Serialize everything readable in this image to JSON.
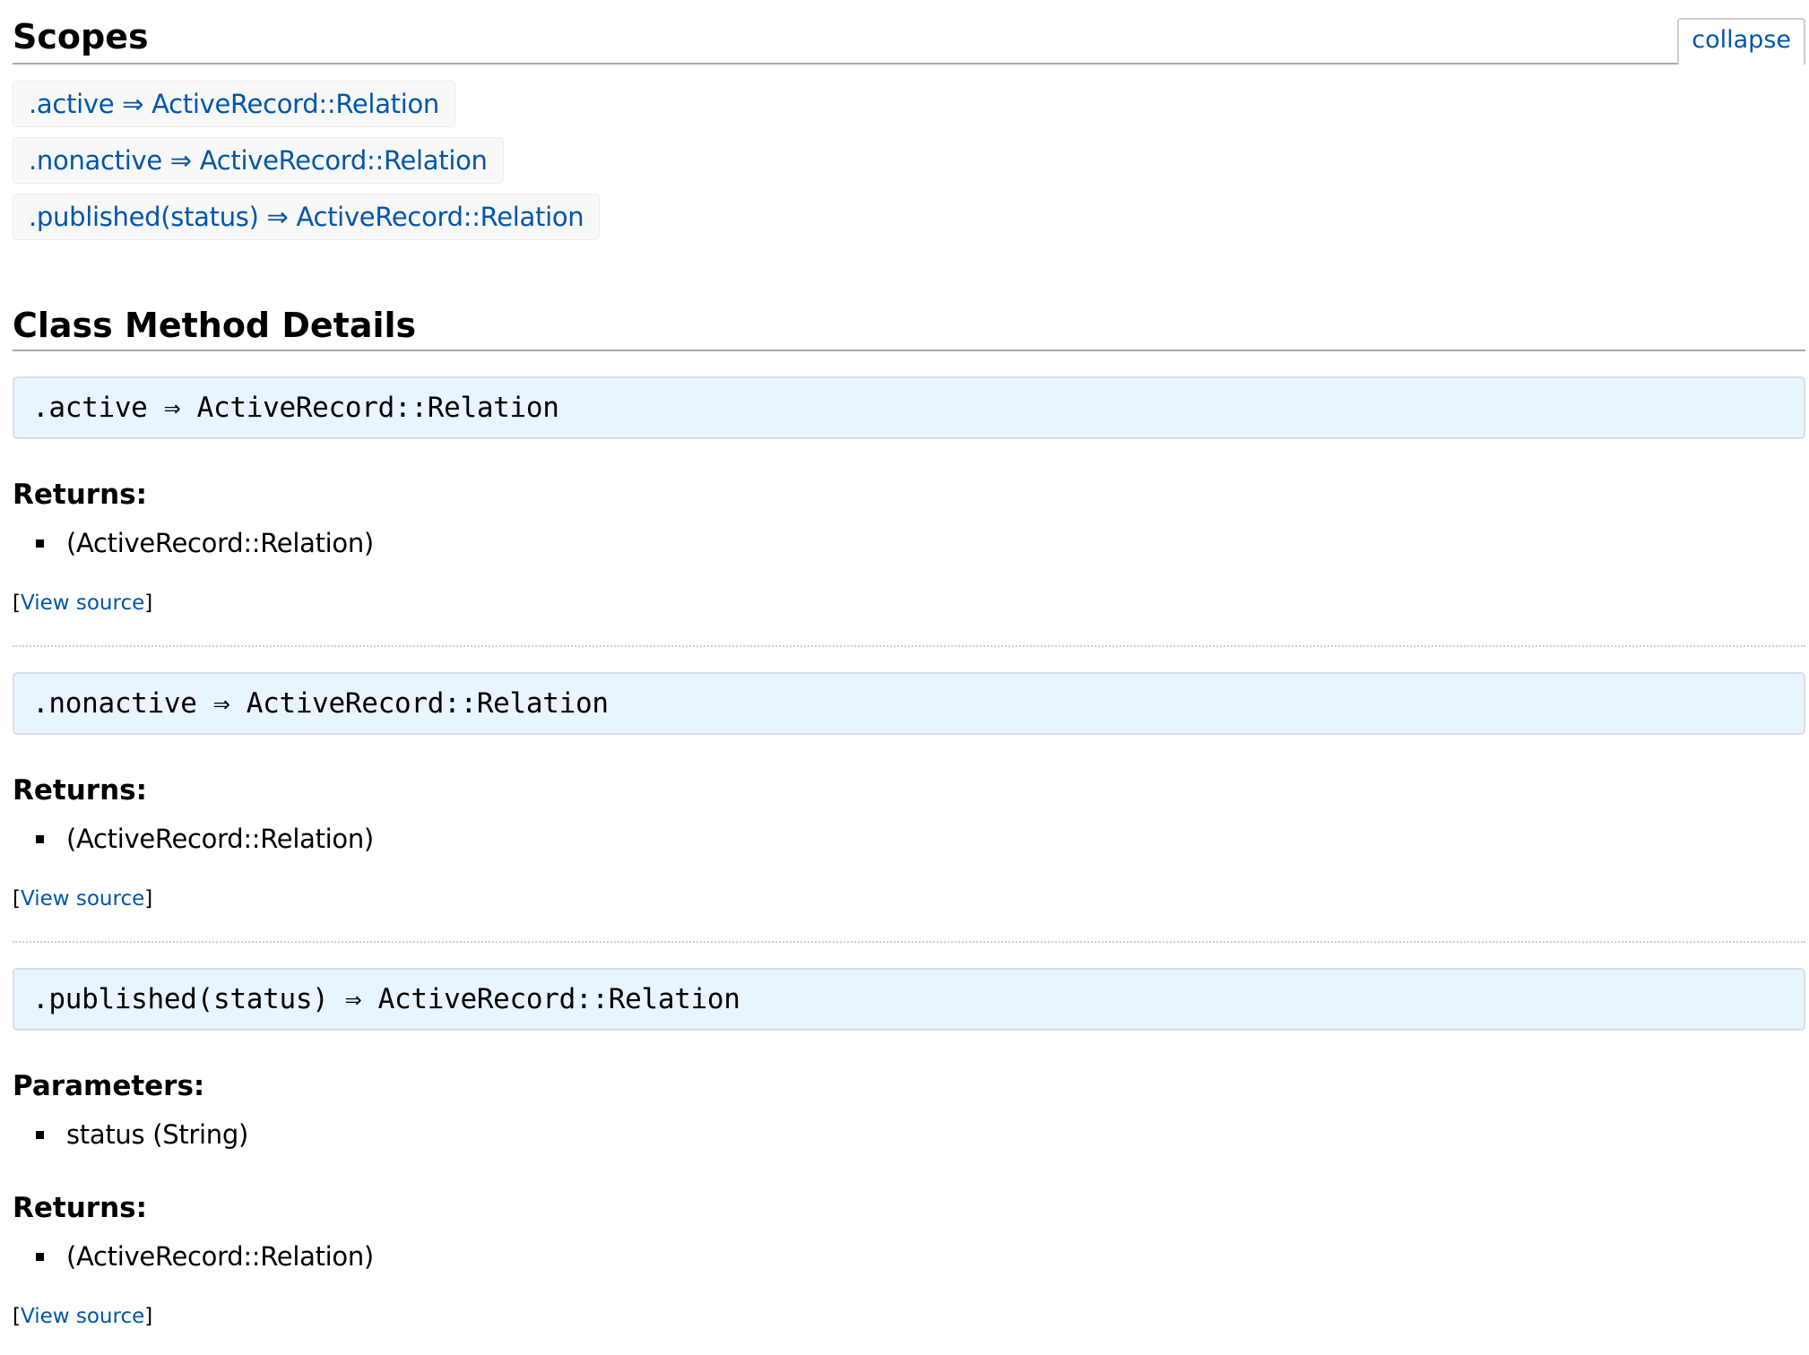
{
  "scopes": {
    "title": "Scopes",
    "collapse_label": "collapse",
    "items": [
      {
        "label": ".active ⇒ ActiveRecord::Relation"
      },
      {
        "label": ".nonactive ⇒ ActiveRecord::Relation"
      },
      {
        "label": ".published(status) ⇒ ActiveRecord::Relation"
      }
    ]
  },
  "details": {
    "title": "Class Method Details",
    "methods": [
      {
        "signature": ".active  ⇒ ActiveRecord::Relation",
        "returns_title": "Returns:",
        "returns": "(ActiveRecord::Relation)",
        "view_source_open": "[",
        "view_source_label": "View source",
        "view_source_close": "]"
      },
      {
        "signature": ".nonactive  ⇒ ActiveRecord::Relation",
        "returns_title": "Returns:",
        "returns": "(ActiveRecord::Relation)",
        "view_source_open": "[",
        "view_source_label": "View source",
        "view_source_close": "]"
      },
      {
        "signature": ".published(status)  ⇒ ActiveRecord::Relation",
        "params_title": "Parameters:",
        "params": "status (String)",
        "returns_title": "Returns:",
        "returns": "(ActiveRecord::Relation)",
        "view_source_open": "[",
        "view_source_label": "View source",
        "view_source_close": "]"
      }
    ]
  }
}
